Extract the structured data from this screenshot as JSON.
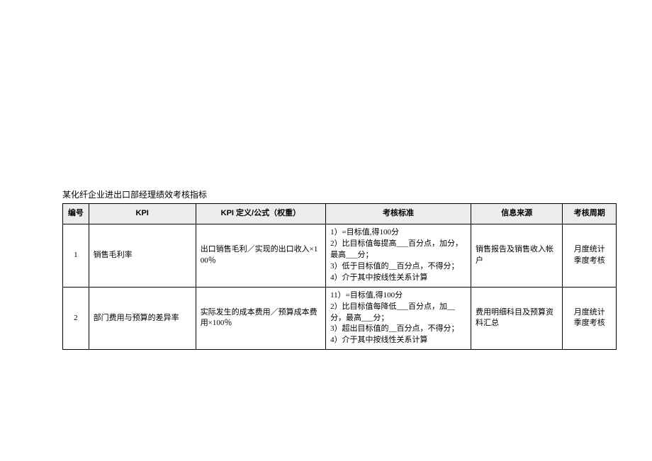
{
  "title": "某化纤企业进出口部经理绩效考核指标",
  "headers": {
    "no": "编号",
    "kpi": "KPI",
    "def": "KPI 定义/公式（权重）",
    "std": "考核标准",
    "src": "信息来源",
    "cycle": "考核周期"
  },
  "rows": [
    {
      "no": "1",
      "kpi": "销售毛利率",
      "def": "出口销售毛利／实现的出口收入×100％",
      "std": "1）=目标值,得100分\n2）比目标值每提高___百分点，加分，最高___分；\n3）低于目标值的__百分点，不得分；\n4）介于其中按线性关系计算",
      "src": "销售报告及销售收入帐户",
      "cycle": "月度统计\n季度考核"
    },
    {
      "no": "2",
      "kpi": "部门费用与预算的差异率",
      "def": "实际发生的成本费用／预算成本费用×100％",
      "std": "11）=目标值,得100分\n2）比目标值每降低___百分点，加__分，最高___分；\n3）超出目标值的__百分点，不得分；\n4）介于其中按线性关系计算",
      "src": "费用明细科目及预算资料汇总",
      "cycle": "月度统计\n季度考核"
    }
  ]
}
